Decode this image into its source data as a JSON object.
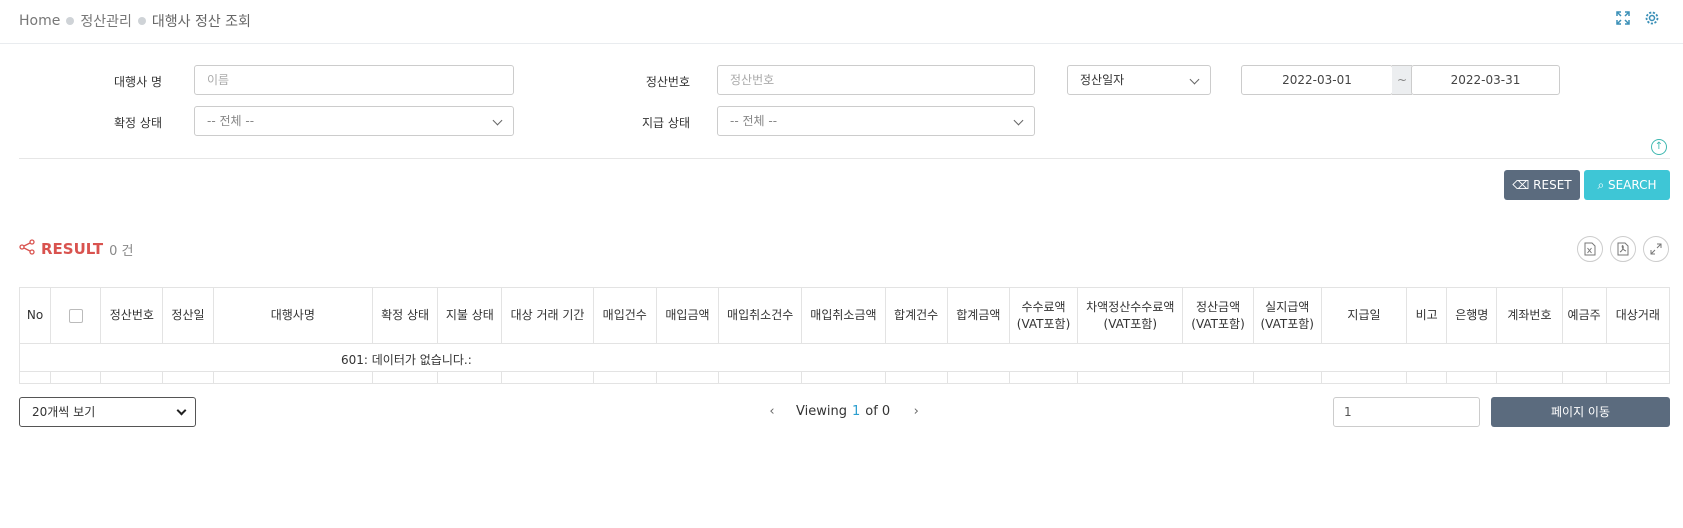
{
  "breadcrumb": {
    "home": "Home",
    "section": "정산관리",
    "page": "대행사 정산 조회"
  },
  "filters": {
    "agency_label": "대행사 명",
    "agency_placeholder": "이름",
    "settle_no_label": "정산번호",
    "settle_no_placeholder": "정산번호",
    "date_type_selected": "정산일자",
    "date_from": "2022-03-01",
    "date_sep": "~",
    "date_to": "2022-03-31",
    "confirm_label": "확정 상태",
    "confirm_selected": "-- 전체 --",
    "pay_label": "지급 상태",
    "pay_selected": "-- 전체 --"
  },
  "buttons": {
    "reset": "RESET",
    "search": "SEARCH"
  },
  "result": {
    "title": "RESULT",
    "count": "0 건"
  },
  "table": {
    "headers": [
      "No",
      "",
      "정산번호",
      "정산일",
      "대행사명",
      "확정 상태",
      "지불 상태",
      "대상 거래 기간",
      "매입건수",
      "매입금액",
      "매입취소건수",
      "매입취소금액",
      "합계건수",
      "합계금액",
      "수수료액\n(VAT포함)",
      "차액정산수수료액\n(VAT포함)",
      "정산금액\n(VAT포함)",
      "실지급액\n(VAT포함)",
      "지급일",
      "비고",
      "은행명",
      "계좌번호",
      "예금주",
      "대상거래"
    ],
    "no_data": "601: 데이터가 없습니다.:"
  },
  "pagination": {
    "page_size": "20개씩 보기",
    "viewing_prefix": "Viewing",
    "current": "1",
    "of_text": "of 0",
    "page_input": "1",
    "goto": "페이지 이동"
  },
  "icons": {
    "fullscreen": "fullscreen-icon",
    "settings": "gear-icon",
    "share": "share-icon",
    "excel": "excel-icon",
    "pdf": "pdf-icon",
    "expand": "expand-icon",
    "collapse": "arrow-up-circle-icon"
  },
  "colors": {
    "accent": "#3ec6d6",
    "reset": "#5b6b7e",
    "result": "#d9534f",
    "icon": "#3a8fb7"
  }
}
